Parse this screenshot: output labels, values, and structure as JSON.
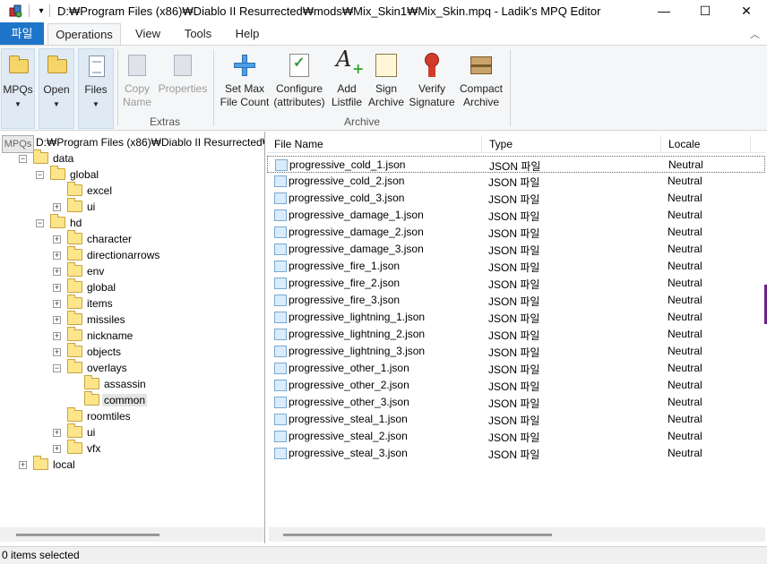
{
  "window": {
    "title": "D:₩Program Files (x86)₩Diablo II Resurrected₩mods₩Mix_Skin1₩Mix_Skin.mpq - Ladik's MPQ Editor",
    "minimize_glyph": "—",
    "maximize_glyph": "☐",
    "close_glyph": "✕",
    "qa_dropdown_glyph": "▾"
  },
  "tabs": {
    "file": "파일",
    "operations": "Operations",
    "view": "View",
    "tools": "Tools",
    "help": "Help",
    "collapse_glyph": "︿"
  },
  "ribbon": {
    "mpqs": "MPQs",
    "open": "Open",
    "files": "Files",
    "copy_name": "Copy Name",
    "properties": "Properties",
    "extras_group": "Extras",
    "set_max_file_count": "Set Max File Count",
    "configure_attributes": "Configure (attributes)",
    "add_listfile": "Add Listfile",
    "sign_archive": "Sign Archive",
    "verify_signature": "Verify Signature",
    "compact_archive": "Compact Archive",
    "archive_group": "Archive",
    "dropdown_arrow": "▼"
  },
  "tree": {
    "badge": "MPQs",
    "root": "D:₩Program Files (x86)₩Diablo II Resurrected₩",
    "nodes": [
      {
        "label": "data",
        "exp": "−"
      },
      {
        "label": "global",
        "exp": "−"
      },
      {
        "label": "excel",
        "exp": ""
      },
      {
        "label": "ui",
        "exp": "+"
      },
      {
        "label": "hd",
        "exp": "−"
      },
      {
        "label": "character",
        "exp": "+"
      },
      {
        "label": "directionarrows",
        "exp": "+"
      },
      {
        "label": "env",
        "exp": "+"
      },
      {
        "label": "global",
        "exp": "+"
      },
      {
        "label": "items",
        "exp": "+"
      },
      {
        "label": "missiles",
        "exp": "+"
      },
      {
        "label": "nickname",
        "exp": "+"
      },
      {
        "label": "objects",
        "exp": "+"
      },
      {
        "label": "overlays",
        "exp": "−"
      },
      {
        "label": "assassin",
        "exp": ""
      },
      {
        "label": "common",
        "exp": ""
      },
      {
        "label": "roomtiles",
        "exp": ""
      },
      {
        "label": "ui",
        "exp": "+"
      },
      {
        "label": "vfx",
        "exp": "+"
      },
      {
        "label": "local",
        "exp": "+"
      }
    ]
  },
  "list": {
    "columns": [
      "File Name",
      "Type",
      "Locale"
    ],
    "rows": [
      {
        "name": "progressive_cold_1.json",
        "type": "JSON 파일",
        "locale": "Neutral"
      },
      {
        "name": "progressive_cold_2.json",
        "type": "JSON 파일",
        "locale": "Neutral"
      },
      {
        "name": "progressive_cold_3.json",
        "type": "JSON 파일",
        "locale": "Neutral"
      },
      {
        "name": "progressive_damage_1.json",
        "type": "JSON 파일",
        "locale": "Neutral"
      },
      {
        "name": "progressive_damage_2.json",
        "type": "JSON 파일",
        "locale": "Neutral"
      },
      {
        "name": "progressive_damage_3.json",
        "type": "JSON 파일",
        "locale": "Neutral"
      },
      {
        "name": "progressive_fire_1.json",
        "type": "JSON 파일",
        "locale": "Neutral"
      },
      {
        "name": "progressive_fire_2.json",
        "type": "JSON 파일",
        "locale": "Neutral"
      },
      {
        "name": "progressive_fire_3.json",
        "type": "JSON 파일",
        "locale": "Neutral"
      },
      {
        "name": "progressive_lightning_1.json",
        "type": "JSON 파일",
        "locale": "Neutral"
      },
      {
        "name": "progressive_lightning_2.json",
        "type": "JSON 파일",
        "locale": "Neutral"
      },
      {
        "name": "progressive_lightning_3.json",
        "type": "JSON 파일",
        "locale": "Neutral"
      },
      {
        "name": "progressive_other_1.json",
        "type": "JSON 파일",
        "locale": "Neutral"
      },
      {
        "name": "progressive_other_2.json",
        "type": "JSON 파일",
        "locale": "Neutral"
      },
      {
        "name": "progressive_other_3.json",
        "type": "JSON 파일",
        "locale": "Neutral"
      },
      {
        "name": "progressive_steal_1.json",
        "type": "JSON 파일",
        "locale": "Neutral"
      },
      {
        "name": "progressive_steal_2.json",
        "type": "JSON 파일",
        "locale": "Neutral"
      },
      {
        "name": "progressive_steal_3.json",
        "type": "JSON 파일",
        "locale": "Neutral"
      }
    ]
  },
  "status": {
    "text": "0 items selected"
  },
  "colors": {
    "file_tab": "#1e74c8",
    "ribbon_bg": "#f5f6f7",
    "folder": "#fde58a"
  }
}
